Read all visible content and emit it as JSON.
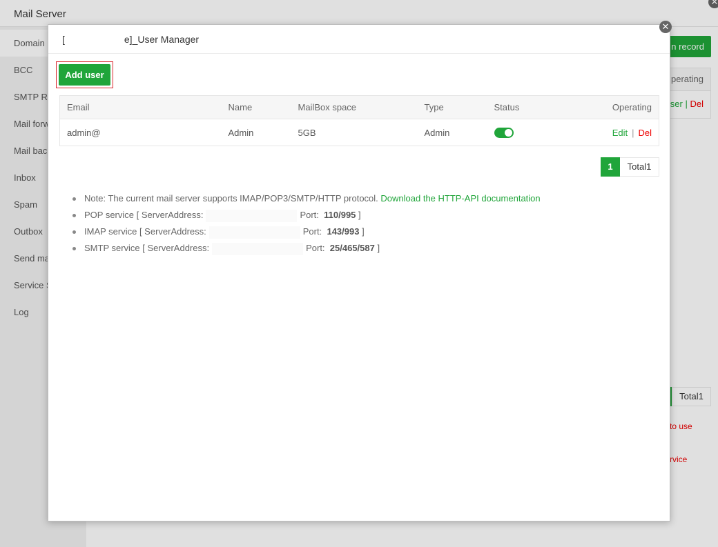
{
  "outer": {
    "title": "Mail Server",
    "sidebar": [
      "Domain m",
      "BCC",
      "SMTP Re",
      "Mail forw",
      "Mail back",
      "Inbox",
      "Spam",
      "Outbox",
      "Send ma",
      "Service S",
      "Log"
    ],
    "add_record": "n record",
    "table_head": "perating",
    "row_user": "ser |",
    "row_del": "Del",
    "page_total": "Total1",
    "red_text1": "to use",
    "red_text2": "rvice"
  },
  "modal": {
    "title_prefix": "[",
    "title_suffix": "e]_User Manager",
    "add_user_label": "Add user",
    "table": {
      "headers": [
        "Email",
        "Name",
        "MailBox space",
        "Type",
        "Status",
        "Operating"
      ],
      "rows": [
        {
          "email": "admin@",
          "name": "Admin",
          "space": "5GB",
          "type": "Admin",
          "status_on": true,
          "edit": "Edit",
          "sep": "|",
          "del": "Del"
        }
      ]
    },
    "pager": {
      "page": "1",
      "total": "Total1"
    },
    "notes": {
      "note_text": "Note: The current mail server supports IMAP/POP3/SMTP/HTTP protocol.",
      "note_link": "Download the HTTP-API documentation",
      "pop_label": "POP service [ ServerAddress:",
      "pop_port_label": "Port:",
      "pop_port": "110/995",
      "imap_label": "IMAP service [ ServerAddress:",
      "imap_port_label": "Port:",
      "imap_port": "143/993",
      "smtp_label": "SMTP service [ ServerAddress:",
      "smtp_port_label": "Port:",
      "smtp_port": "25/465/587",
      "close_bracket": "]"
    }
  },
  "colors": {
    "accent": "#20a53a",
    "danger": "#e00000",
    "highlight_border": "#d9262b"
  }
}
